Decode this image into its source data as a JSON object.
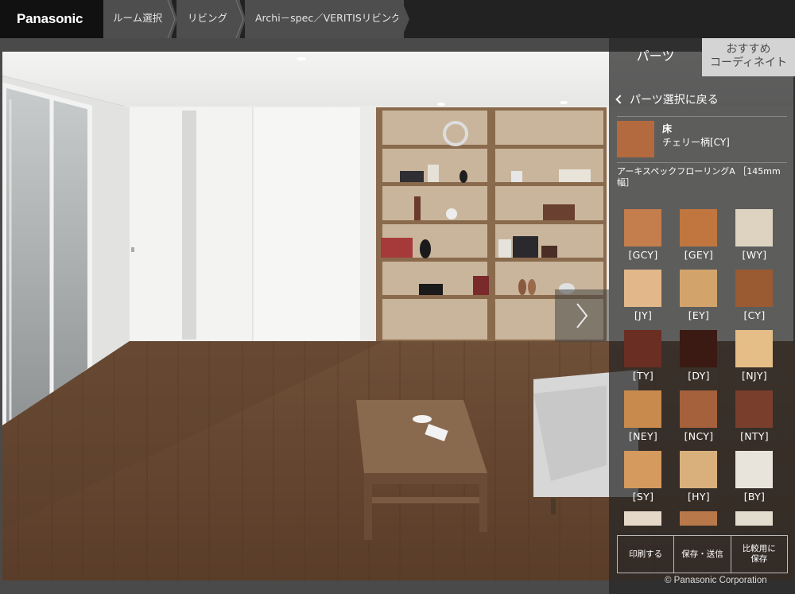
{
  "header": {
    "brand": "Panasonic",
    "breadcrumbs": [
      "ルーム選択",
      "リビング",
      "Archi－spec／VERITISリビング"
    ]
  },
  "panel": {
    "tabs": [
      "パーツ",
      "おすすめ\nコーディネイト"
    ],
    "back_label": "パーツ選択に戻る",
    "current": {
      "category": "床",
      "name": "チェリー柄[CY]",
      "color": "#b36a3e"
    },
    "product_name": "アーキスペックフローリングA ［145mm幅］",
    "swatches": [
      {
        "label": "[GCY]",
        "color": "#c47d4c"
      },
      {
        "label": "[GEY]",
        "color": "#c0763e"
      },
      {
        "label": "[WY]",
        "color": "#ddd3c0"
      },
      {
        "label": "[JY]",
        "color": "#e2b88a"
      },
      {
        "label": "[EY]",
        "color": "#d2a46b"
      },
      {
        "label": "[CY]",
        "color": "#9a5a32"
      },
      {
        "label": "[TY]",
        "color": "#6a2e22"
      },
      {
        "label": "[DY]",
        "color": "#3a1a12"
      },
      {
        "label": "[NJY]",
        "color": "#e5bd86"
      },
      {
        "label": "[NEY]",
        "color": "#c98a4e"
      },
      {
        "label": "[NCY]",
        "color": "#a5603c"
      },
      {
        "label": "[NTY]",
        "color": "#7a3e2c"
      },
      {
        "label": "[SY]",
        "color": "#d49a5e"
      },
      {
        "label": "[HY]",
        "color": "#d9b07c"
      },
      {
        "label": "[BY]",
        "color": "#e8e4dc"
      },
      {
        "label": "",
        "color": "#e6d8c8"
      },
      {
        "label": "",
        "color": "#b8784a"
      },
      {
        "label": "",
        "color": "#e2dccf"
      }
    ],
    "actions": [
      "印刷する",
      "保存・送信",
      "比較用に\n保存"
    ]
  },
  "footer": {
    "copyright": "© Panasonic Corporation"
  },
  "colors": {
    "topbar": "#222222",
    "brand_bg": "#111111",
    "crumb_bg": "#4e4e4e",
    "panel_bg": "#262626"
  }
}
